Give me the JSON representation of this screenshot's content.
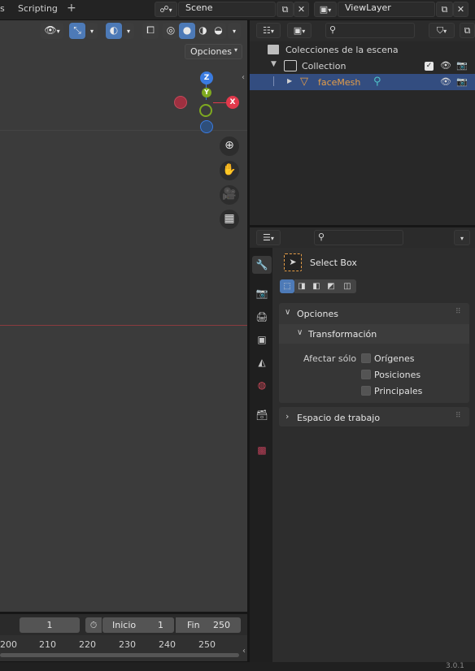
{
  "topbar": {
    "partial_tab": "s",
    "scripting_tab": "Scripting",
    "add_tab": "+",
    "scene_name": "Scene",
    "view_layer_name": "ViewLayer"
  },
  "viewport": {
    "options_label": "Opciones",
    "axes": {
      "z": "Z",
      "y": "Y",
      "x": "X"
    }
  },
  "outliner": {
    "search_placeholder": "",
    "scene_collection": "Colecciones de la escena",
    "collection": "Collection",
    "object": "faceMesh"
  },
  "properties": {
    "search_placeholder": "",
    "tool_name": "Select Box",
    "panel_opciones": "Opciones",
    "subpanel_transform": "Transformación",
    "affect_only_label": "Afectar sólo",
    "checkboxes": [
      {
        "label": "Orígenes",
        "checked": false
      },
      {
        "label": "Posiciones",
        "checked": false
      },
      {
        "label": "Principales",
        "checked": false
      }
    ],
    "panel_workspace": "Espacio de trabajo"
  },
  "timeline": {
    "current_frame": "1",
    "start_label": "Inicio",
    "start_value": "1",
    "end_label": "Fin",
    "end_value": "250",
    "ruler": [
      "200",
      "210",
      "220",
      "230",
      "240",
      "250"
    ]
  },
  "status": {
    "version": "3.0.1"
  },
  "colors": {
    "accent_blue": "#4d7ab7",
    "object_orange": "#e59e48",
    "axis_x": "#e2394c",
    "axis_y": "#7fa920",
    "axis_z": "#3a7be0"
  }
}
